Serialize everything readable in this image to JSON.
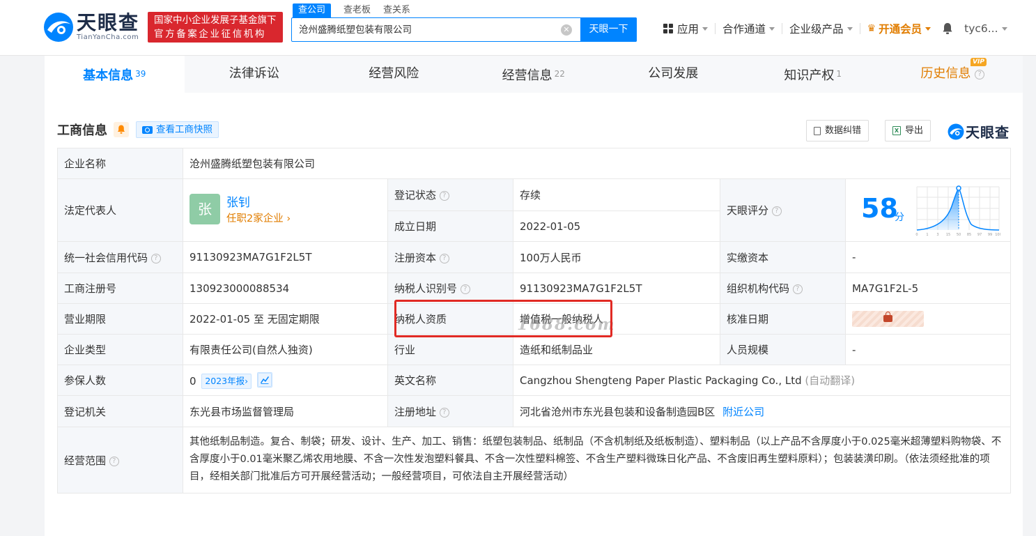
{
  "header": {
    "logo_cn": "天眼查",
    "logo_en": "TianYanCha.com",
    "badge_line1": "国家中小企业发展子基金旗下",
    "badge_line2": "官方备案企业征信机构",
    "search_tabs": [
      "查公司",
      "查老板",
      "查关系"
    ],
    "search_value": "沧州盛腾纸塑包装有限公司",
    "search_button": "天眼一下",
    "nav": {
      "apps": "应用",
      "channel": "合作通道",
      "enterprise": "企业级产品",
      "vip": "开通会员",
      "user": "tyc6..."
    }
  },
  "tabs": [
    {
      "label": "基本信息",
      "count": "39"
    },
    {
      "label": "法律诉讼",
      "count": ""
    },
    {
      "label": "经营风险",
      "count": ""
    },
    {
      "label": "经营信息",
      "count": "22"
    },
    {
      "label": "公司发展",
      "count": ""
    },
    {
      "label": "知识产权",
      "count": "1"
    },
    {
      "label": "历史信息",
      "count": "",
      "tag": "VIP"
    }
  ],
  "section": {
    "title": "工商信息",
    "snapshot_btn": "查看工商快照",
    "correction_btn": "数据纠错",
    "export_btn": "导出",
    "watermark_logo": "天眼查"
  },
  "info": {
    "company_name_label": "企业名称",
    "company_name": "沧州盛腾纸塑包装有限公司",
    "legal_rep_label": "法定代表人",
    "legal_rep_avatar": "张",
    "legal_rep_name": "张钊",
    "legal_rep_sub": "任职2家企业",
    "reg_status_label": "登记状态",
    "reg_status": "存续",
    "found_date_label": "成立日期",
    "found_date": "2022-01-05",
    "score_label": "天眼评分",
    "score": "58",
    "score_unit": "分",
    "credit_code_label": "统一社会信用代码",
    "credit_code": "91130923MA7G1F2L5T",
    "reg_capital_label": "注册资本",
    "reg_capital": "100万人民币",
    "paid_capital_label": "实缴资本",
    "paid_capital": "-",
    "biz_reg_no_label": "工商注册号",
    "biz_reg_no": "130923000088534",
    "taxpayer_id_label": "纳税人识别号",
    "taxpayer_id": "91130923MA7G1F2L5T",
    "org_code_label": "组织机构代码",
    "org_code": "MA7G1F2L-5",
    "biz_term_label": "营业期限",
    "biz_term": "2022-01-05 至 无固定期限",
    "taxpayer_qual_label": "纳税人资质",
    "taxpayer_qual": "增值税一般纳税人",
    "approve_date_label": "核准日期",
    "company_type_label": "企业类型",
    "company_type": "有限责任公司(自然人独资)",
    "industry_label": "行业",
    "industry": "造纸和纸制品业",
    "staff_size_label": "人员规模",
    "staff_size": "-",
    "insured_label": "参保人数",
    "insured": "0",
    "insured_year": "2023年报",
    "en_name_label": "英文名称",
    "en_name": "Cangzhou Shengteng Paper Plastic Packaging Co., Ltd",
    "en_name_note": "(自动翻译)",
    "reg_authority_label": "登记机关",
    "reg_authority": "东光县市场监督管理局",
    "reg_address_label": "注册地址",
    "reg_address": "河北省沧州市东光县包装和设备制造园B区",
    "nearby_link": "附近公司",
    "scope_label": "经营范围",
    "scope": "其他纸制品制造。复合、制袋；研发、设计、生产、加工、销售：纸塑包装制品、纸制品（不含机制纸及纸板制造）、塑料制品（以上产品不含厚度小于0.025毫米超薄塑料购物袋、不含厚度小于0.01毫米聚乙烯农用地膜、不含一次性发泡塑料餐具、不含一次性塑料棉签、不含生产塑料微珠日化产品、不含废旧再生塑料原料）；包装装潢印刷。（依法须经批准的项目，经相关部门批准后方可开展经营活动；一般经营项目，可依法自主开展经营活动）"
  },
  "score_chart": {
    "ticks": [
      "0",
      "1",
      "3",
      "15",
      "50",
      "85",
      "97",
      "99",
      "100"
    ]
  },
  "watermark": "1688.com"
}
